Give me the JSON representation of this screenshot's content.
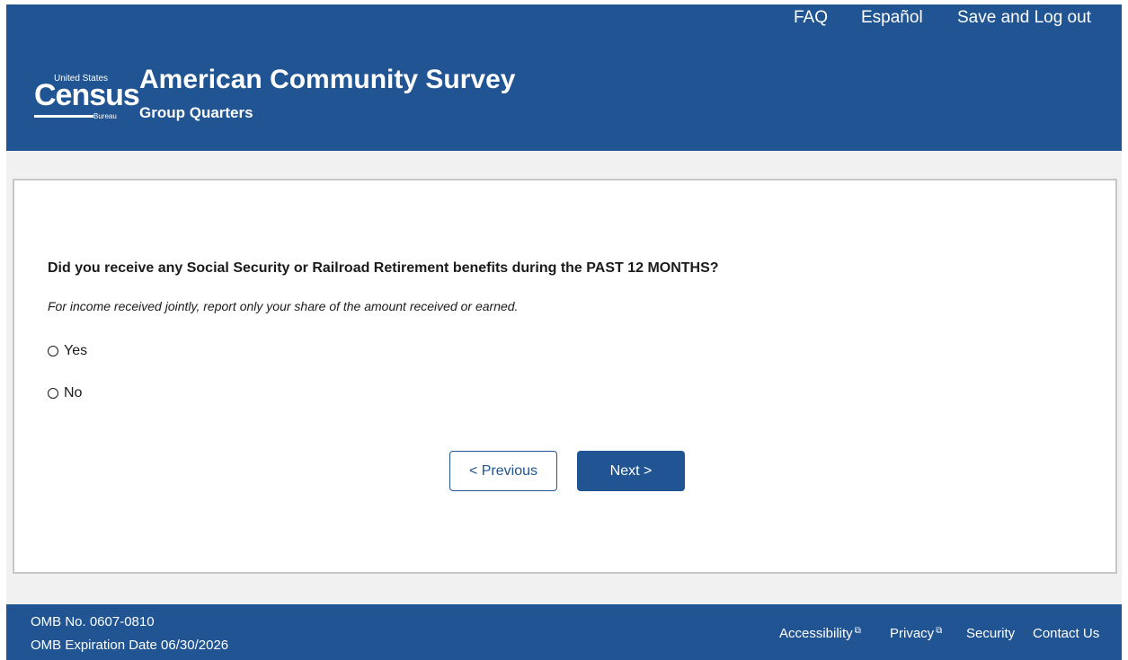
{
  "top_nav": {
    "faq": "FAQ",
    "espanol": "Español",
    "save_logout": "Save and Log out"
  },
  "logo": {
    "small": "United States",
    "big": "Census",
    "bureau": "Bureau"
  },
  "header": {
    "title": "American Community Survey",
    "subtitle": "Group Quarters"
  },
  "question": {
    "text": "Did you receive any Social Security or Railroad Retirement benefits during the PAST 12 MONTHS?",
    "instruction": "For income received jointly, report only your share of the amount received or earned.",
    "options": [
      "Yes",
      "No"
    ]
  },
  "buttons": {
    "previous": "< Previous",
    "next": "Next >"
  },
  "footer": {
    "omb_number": "OMB No. 0607-0810",
    "omb_expiration": "OMB Expiration Date 06/30/2026",
    "accessibility": "Accessibility",
    "privacy": "Privacy",
    "security": "Security",
    "contact": "Contact Us",
    "external_icon": "external-link-icon"
  },
  "colors": {
    "brand_blue": "#205493",
    "band_gray": "#f1f1f1"
  }
}
